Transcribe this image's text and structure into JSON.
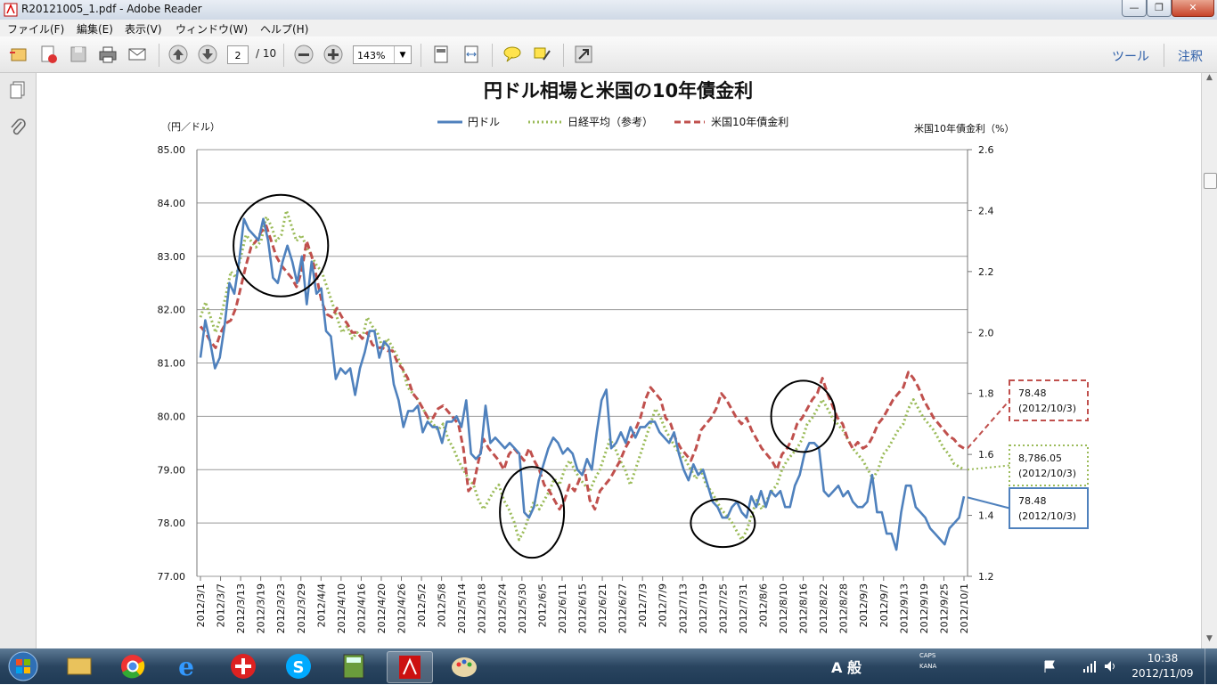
{
  "window": {
    "title": "R20121005_1.pdf - Adobe Reader",
    "icon": "adobe-reader-icon",
    "minimize_label": "—",
    "maximize_label": "❐",
    "close_label": "✕"
  },
  "menu": [
    {
      "label": "ファイル(F)"
    },
    {
      "label": "編集(E)"
    },
    {
      "label": "表示(V)"
    },
    {
      "label": "ウィンドウ(W)"
    },
    {
      "label": "ヘルプ(H)"
    }
  ],
  "toolbar": {
    "page_current": "2",
    "page_total": "/ 10",
    "zoom": "143%",
    "tools_label": "ツール",
    "comment_label": "注釈"
  },
  "chart_data": {
    "type": "line",
    "title": "円ドル相場と米国の10年債金利",
    "ylabel_left": "（円／ドル）",
    "ylabel_right": "米国10年債金利（%）",
    "legend": [
      "円ドル",
      "日経平均（参考）",
      "米国10年債金利"
    ],
    "legend_placement": "top-center",
    "grid": true,
    "y_left_ticks": [
      "85.00",
      "84.00",
      "83.00",
      "82.00",
      "81.00",
      "80.00",
      "79.00",
      "78.00",
      "77.00"
    ],
    "y_left_range": [
      77,
      85
    ],
    "y_right_ticks": [
      "2.6",
      "2.4",
      "2.2",
      "2.0",
      "1.8",
      "1.6",
      "1.4",
      "1.2"
    ],
    "y_right_range": [
      1.2,
      2.6
    ],
    "x_ticks": [
      "2012/3/1",
      "2012/3/7",
      "2012/3/13",
      "2012/3/19",
      "2012/3/23",
      "2012/3/29",
      "2012/4/4",
      "2012/4/10",
      "2012/4/16",
      "2012/4/20",
      "2012/4/26",
      "2012/5/2",
      "2012/5/8",
      "2012/5/14",
      "2012/5/18",
      "2012/5/24",
      "2012/5/30",
      "2012/6/5",
      "2012/6/11",
      "2012/6/15",
      "2012/6/21",
      "2012/6/27",
      "2012/7/3",
      "2012/7/9",
      "2012/7/13",
      "2012/7/19",
      "2012/7/25",
      "2012/7/31",
      "2012/8/6",
      "2012/8/10",
      "2012/8/16",
      "2012/8/22",
      "2012/8/28",
      "2012/9/3",
      "2012/9/7",
      "2012/9/13",
      "2012/9/19",
      "2012/9/25",
      "2012/10/1"
    ],
    "series": [
      {
        "name": "円ドル",
        "axis": "left",
        "color": "#4f81bd",
        "style": "solid",
        "values": [
          81.1,
          81.8,
          81.4,
          80.9,
          81.1,
          81.7,
          82.5,
          82.3,
          82.9,
          83.7,
          83.5,
          83.4,
          83.3,
          83.7,
          83.3,
          82.6,
          82.5,
          82.9,
          83.2,
          82.9,
          82.5,
          83.0,
          82.1,
          82.9,
          82.3,
          82.4,
          81.6,
          81.5,
          80.7,
          80.9,
          80.8,
          80.9,
          80.4,
          80.9,
          81.2,
          81.6,
          81.6,
          81.1,
          81.4,
          81.3,
          80.6,
          80.3,
          79.8,
          80.1,
          80.1,
          80.2,
          79.7,
          79.9,
          79.8,
          79.8,
          79.5,
          79.9,
          79.9,
          80.0,
          79.8,
          80.3,
          79.3,
          79.2,
          79.3,
          80.2,
          79.5,
          79.6,
          79.5,
          79.4,
          79.5,
          79.4,
          79.3,
          78.2,
          78.1,
          78.3,
          78.8,
          79.1,
          79.4,
          79.6,
          79.5,
          79.3,
          79.4,
          79.3,
          79.0,
          78.9,
          79.2,
          79.0,
          79.7,
          80.3,
          80.5,
          79.4,
          79.5,
          79.7,
          79.5,
          79.8,
          79.6,
          79.8,
          79.8,
          79.9,
          79.9,
          79.7,
          79.6,
          79.5,
          79.7,
          79.3,
          79.0,
          78.8,
          79.1,
          78.9,
          79.0,
          78.7,
          78.4,
          78.3,
          78.1,
          78.1,
          78.3,
          78.4,
          78.2,
          78.1,
          78.5,
          78.3,
          78.6,
          78.3,
          78.6,
          78.5,
          78.6,
          78.3,
          78.3,
          78.7,
          78.9,
          79.3,
          79.5,
          79.5,
          79.4,
          78.6,
          78.5,
          78.6,
          78.7,
          78.5,
          78.6,
          78.4,
          78.3,
          78.3,
          78.4,
          78.9,
          78.2,
          78.2,
          77.8,
          77.8,
          77.5,
          78.2,
          78.7,
          78.7,
          78.3,
          78.2,
          78.1,
          77.9,
          77.8,
          77.7,
          77.6,
          77.9,
          78.0,
          78.1,
          78.5
        ]
      },
      {
        "name": "日経平均（参考）",
        "axis": "right",
        "color": "#9bbb59",
        "style": "dotted",
        "values": [
          2.05,
          2.1,
          2.05,
          2.0,
          2.05,
          2.12,
          2.2,
          2.18,
          2.25,
          2.32,
          2.3,
          2.28,
          2.3,
          2.38,
          2.35,
          2.3,
          2.32,
          2.4,
          2.35,
          2.3,
          2.32,
          2.28,
          2.25,
          2.22,
          2.2,
          2.15,
          2.1,
          2.05,
          2.0,
          2.02,
          1.98,
          2.0,
          1.98,
          2.05,
          2.02,
          2.0,
          1.95,
          1.98,
          1.95,
          1.92,
          1.88,
          1.82,
          1.8,
          1.78,
          1.75,
          1.72,
          1.7,
          1.68,
          1.7,
          1.65,
          1.62,
          1.58,
          1.55,
          1.52,
          1.5,
          1.45,
          1.42,
          1.45,
          1.48,
          1.5,
          1.45,
          1.42,
          1.38,
          1.32,
          1.35,
          1.4,
          1.45,
          1.42,
          1.45,
          1.48,
          1.52,
          1.5,
          1.55,
          1.58,
          1.55,
          1.52,
          1.5,
          1.48,
          1.52,
          1.55,
          1.6,
          1.65,
          1.62,
          1.58,
          1.55,
          1.5,
          1.55,
          1.6,
          1.65,
          1.7,
          1.75,
          1.72,
          1.68,
          1.65,
          1.62,
          1.6,
          1.58,
          1.55,
          1.52,
          1.55,
          1.5,
          1.48,
          1.45,
          1.42,
          1.4,
          1.38,
          1.35,
          1.32,
          1.35,
          1.4,
          1.45,
          1.42,
          1.45,
          1.48,
          1.5,
          1.55,
          1.58,
          1.6,
          1.62,
          1.65,
          1.7,
          1.72,
          1.75,
          1.78,
          1.75,
          1.72,
          1.7,
          1.68,
          1.65,
          1.62,
          1.6,
          1.58,
          1.55,
          1.52,
          1.55,
          1.6,
          1.62,
          1.65,
          1.68,
          1.7,
          1.75,
          1.78,
          1.75,
          1.72,
          1.7,
          1.68,
          1.65,
          1.62,
          1.6,
          1.57,
          1.56,
          1.55
        ]
      },
      {
        "name": "米国10年債金利",
        "axis": "right",
        "color": "#c0504d",
        "style": "dashed",
        "values": [
          2.02,
          2.0,
          1.97,
          1.95,
          2.0,
          2.03,
          2.04,
          2.08,
          2.15,
          2.22,
          2.28,
          2.3,
          2.33,
          2.35,
          2.3,
          2.25,
          2.22,
          2.2,
          2.18,
          2.15,
          2.2,
          2.3,
          2.25,
          2.18,
          2.1,
          2.06,
          2.05,
          2.08,
          2.05,
          2.03,
          2.0,
          2.0,
          1.98,
          2.0,
          1.96,
          1.95,
          1.95,
          1.94,
          1.94,
          1.9,
          1.88,
          1.85,
          1.8,
          1.78,
          1.75,
          1.72,
          1.72,
          1.75,
          1.76,
          1.74,
          1.72,
          1.7,
          1.62,
          1.48,
          1.5,
          1.58,
          1.65,
          1.62,
          1.6,
          1.58,
          1.55,
          1.6,
          1.62,
          1.6,
          1.58,
          1.62,
          1.58,
          1.55,
          1.5,
          1.48,
          1.45,
          1.42,
          1.45,
          1.5,
          1.48,
          1.52,
          1.55,
          1.45,
          1.42,
          1.48,
          1.5,
          1.52,
          1.55,
          1.58,
          1.62,
          1.65,
          1.68,
          1.72,
          1.78,
          1.82,
          1.8,
          1.78,
          1.72,
          1.7,
          1.65,
          1.62,
          1.6,
          1.58,
          1.62,
          1.68,
          1.7,
          1.72,
          1.75,
          1.8,
          1.78,
          1.75,
          1.72,
          1.7,
          1.72,
          1.68,
          1.65,
          1.62,
          1.6,
          1.58,
          1.55,
          1.6,
          1.62,
          1.65,
          1.7,
          1.72,
          1.75,
          1.78,
          1.8,
          1.85,
          1.8,
          1.76,
          1.72,
          1.7,
          1.65,
          1.62,
          1.64,
          1.62,
          1.63,
          1.66,
          1.7,
          1.72,
          1.75,
          1.78,
          1.8,
          1.82,
          1.87,
          1.85,
          1.82,
          1.78,
          1.75,
          1.72,
          1.7,
          1.68,
          1.66,
          1.65,
          1.63,
          1.62
        ]
      }
    ],
    "annotations": [
      {
        "value": "78.48",
        "date": "(2012/10/3)",
        "color": "#c0504d",
        "style": "dashed",
        "axis": "right",
        "anchor_value": 1.62
      },
      {
        "value": "8,786.05",
        "date": "(2012/10/3)",
        "color": "#9bbb59",
        "style": "dotted",
        "axis": "right",
        "anchor_value": 1.55
      },
      {
        "value": "78.48",
        "date": "(2012/10/3)",
        "color": "#4f81bd",
        "style": "solid",
        "axis": "left",
        "anchor_value": 78.48
      }
    ],
    "circled_regions": [
      {
        "x_from": "2012/3/13",
        "x_to": "2012/4/4"
      },
      {
        "x_from": "2012/5/30",
        "x_to": "2012/6/5"
      },
      {
        "x_from": "2012/7/19",
        "x_to": "2012/7/31"
      },
      {
        "x_from": "2012/8/10",
        "x_to": "2012/8/22"
      }
    ]
  },
  "taskbar": {
    "apps": [
      "start-orb",
      "file-explorer-icon",
      "chrome-icon",
      "ie-icon",
      "app-red-icon",
      "skype-icon",
      "calc-icon",
      "adobe-reader-taskbar-icon",
      "paint-icon"
    ],
    "time": "10:38",
    "date": "2012/11/09",
    "ime_label": "A 般",
    "caps_label": "CAPS",
    "kana_label": "KANA"
  }
}
